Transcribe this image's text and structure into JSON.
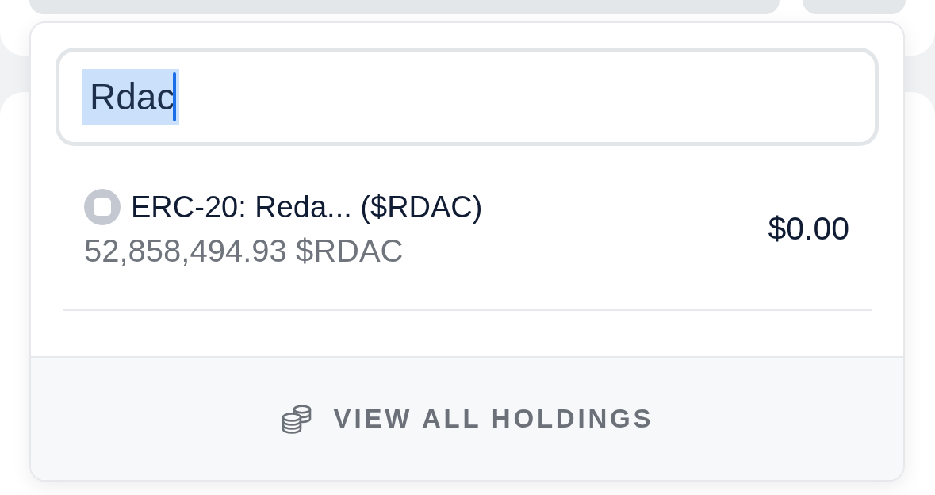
{
  "search": {
    "value": "Rdac",
    "text_selected": true,
    "focused": true
  },
  "results": [
    {
      "name": "ERC-20: Reda... ($RDAC)",
      "balance": "52,858,494.93 $RDAC",
      "value": "$0.00"
    }
  ],
  "footer_button": {
    "label": "VIEW ALL HOLDINGS"
  }
}
